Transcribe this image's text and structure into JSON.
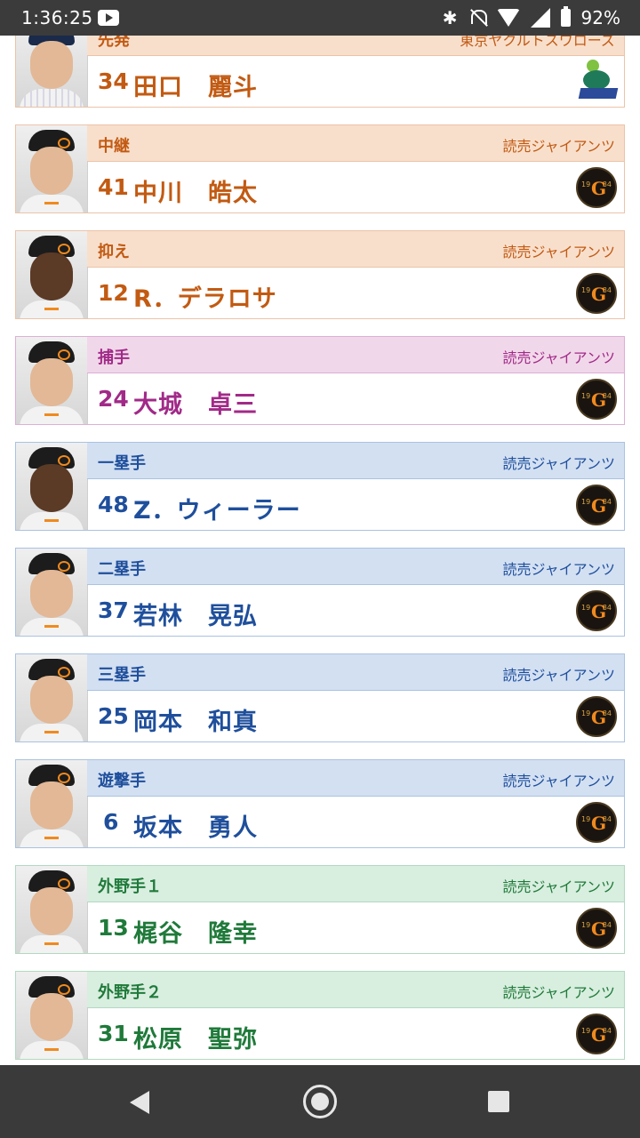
{
  "status_bar": {
    "time": "1:36:25",
    "battery": "92%"
  },
  "teams": {
    "giants": "読売ジャイアンツ",
    "swallows": "東京ヤクルトスワローズ"
  },
  "players": [
    {
      "position": "先発",
      "team": "東京ヤクルトスワローズ",
      "number": "34",
      "name": "田口　麗斗",
      "logo": "swallows-logo",
      "theme": "orange"
    },
    {
      "position": "中継",
      "team": "読売ジャイアンツ",
      "number": "41",
      "name": "中川　皓太",
      "logo": "giants-logo",
      "theme": "orange"
    },
    {
      "position": "抑え",
      "team": "読売ジャイアンツ",
      "number": "12",
      "name": "R．デラロサ",
      "logo": "giants-logo",
      "theme": "orange"
    },
    {
      "position": "捕手",
      "team": "読売ジャイアンツ",
      "number": "24",
      "name": "大城　卓三",
      "logo": "giants-logo",
      "theme": "pink"
    },
    {
      "position": "一塁手",
      "team": "読売ジャイアンツ",
      "number": "48",
      "name": "Z．ウィーラー",
      "logo": "giants-logo",
      "theme": "blue"
    },
    {
      "position": "二塁手",
      "team": "読売ジャイアンツ",
      "number": "37",
      "name": "若林　晃弘",
      "logo": "giants-logo",
      "theme": "blue"
    },
    {
      "position": "三塁手",
      "team": "読売ジャイアンツ",
      "number": "25",
      "name": "岡本　和真",
      "logo": "giants-logo",
      "theme": "blue"
    },
    {
      "position": "遊撃手",
      "team": "読売ジャイアンツ",
      "number": "6",
      "name": "坂本　勇人",
      "logo": "giants-logo",
      "theme": "blue"
    },
    {
      "position": "外野手１",
      "team": "読売ジャイアンツ",
      "number": "13",
      "name": "梶谷　隆幸",
      "logo": "giants-logo",
      "theme": "green"
    },
    {
      "position": "外野手２",
      "team": "読売ジャイアンツ",
      "number": "31",
      "name": "松原　聖弥",
      "logo": "giants-logo",
      "theme": "green"
    }
  ],
  "giants_logo": {
    "letter": "G",
    "year_left": "19",
    "year_right": "34"
  },
  "colors": {
    "orange": "#c25a12",
    "pink": "#a12a88",
    "blue": "#1f4f9c",
    "green": "#1f7a3a"
  },
  "nav": {
    "back": "back-icon",
    "home": "home-icon",
    "recents": "recents-icon"
  }
}
